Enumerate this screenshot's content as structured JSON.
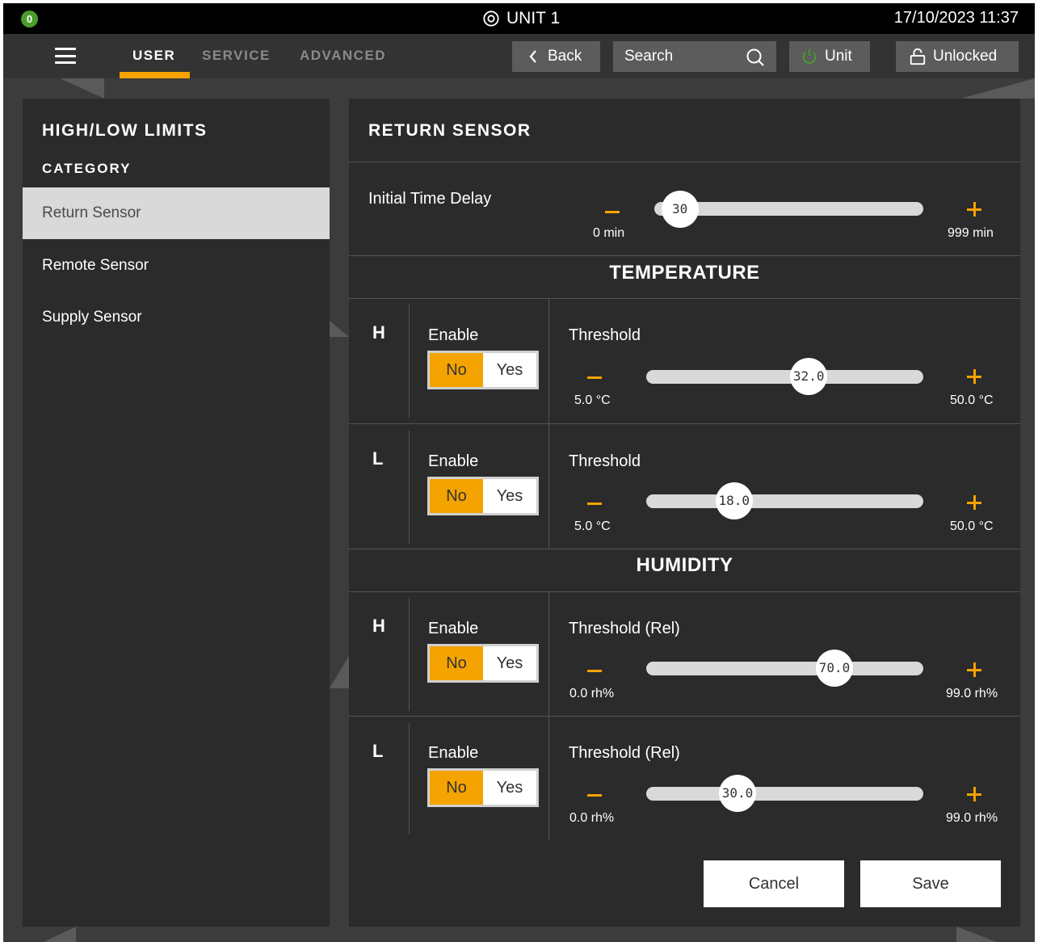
{
  "header": {
    "status_badge": "0",
    "unit_title": "UNIT 1",
    "datetime": "17/10/2023 11:37"
  },
  "nav": {
    "tabs": [
      "USER",
      "SERVICE",
      "ADVANCED"
    ],
    "active_tab": "USER",
    "back_label": "Back",
    "search_placeholder": "Search",
    "unit_label": "Unit",
    "lock_label": "Unlocked"
  },
  "sidebar": {
    "title": "HIGH/LOW LIMITS",
    "category_label": "CATEGORY",
    "items": [
      {
        "label": "Return Sensor",
        "selected": true
      },
      {
        "label": "Remote Sensor",
        "selected": false
      },
      {
        "label": "Supply Sensor",
        "selected": false
      }
    ]
  },
  "main": {
    "title": "RETURN SENSOR",
    "initial_delay": {
      "label": "Initial Time Delay",
      "value": "30",
      "value_num": 30,
      "min_num": 0,
      "max_num": 999,
      "min_label": "0 min",
      "max_label": "999 min"
    },
    "temperature": {
      "title": "TEMPERATURE",
      "rows": [
        {
          "level": "H",
          "enable_label": "Enable",
          "toggle_no": "No",
          "toggle_yes": "Yes",
          "enabled": "No",
          "threshold_label": "Threshold",
          "value": "32.0",
          "value_num": 32.0,
          "min_num": 5.0,
          "max_num": 50.0,
          "min_label": "5.0 °C",
          "max_label": "50.0 °C"
        },
        {
          "level": "L",
          "enable_label": "Enable",
          "toggle_no": "No",
          "toggle_yes": "Yes",
          "enabled": "No",
          "threshold_label": "Threshold",
          "value": "18.0",
          "value_num": 18.0,
          "min_num": 5.0,
          "max_num": 50.0,
          "min_label": "5.0 °C",
          "max_label": "50.0 °C"
        }
      ]
    },
    "humidity": {
      "title": "HUMIDITY",
      "rows": [
        {
          "level": "H",
          "enable_label": "Enable",
          "toggle_no": "No",
          "toggle_yes": "Yes",
          "enabled": "No",
          "threshold_label": "Threshold (Rel)",
          "value": "70.0",
          "value_num": 70.0,
          "min_num": 0.0,
          "max_num": 99.0,
          "min_label": "0.0 rh%",
          "max_label": "99.0 rh%"
        },
        {
          "level": "L",
          "enable_label": "Enable",
          "toggle_no": "No",
          "toggle_yes": "Yes",
          "enabled": "No",
          "threshold_label": "Threshold (Rel)",
          "value": "30.0",
          "value_num": 30.0,
          "min_num": 0.0,
          "max_num": 99.0,
          "min_label": "0.0 rh%",
          "max_label": "99.0 rh%"
        }
      ]
    },
    "cancel_label": "Cancel",
    "save_label": "Save"
  },
  "colors": {
    "accent": "#f5a300",
    "status_green": "#4a9d2b",
    "panel_bg": "#2b2b2b",
    "selected_item_bg": "#d9d9d9"
  }
}
